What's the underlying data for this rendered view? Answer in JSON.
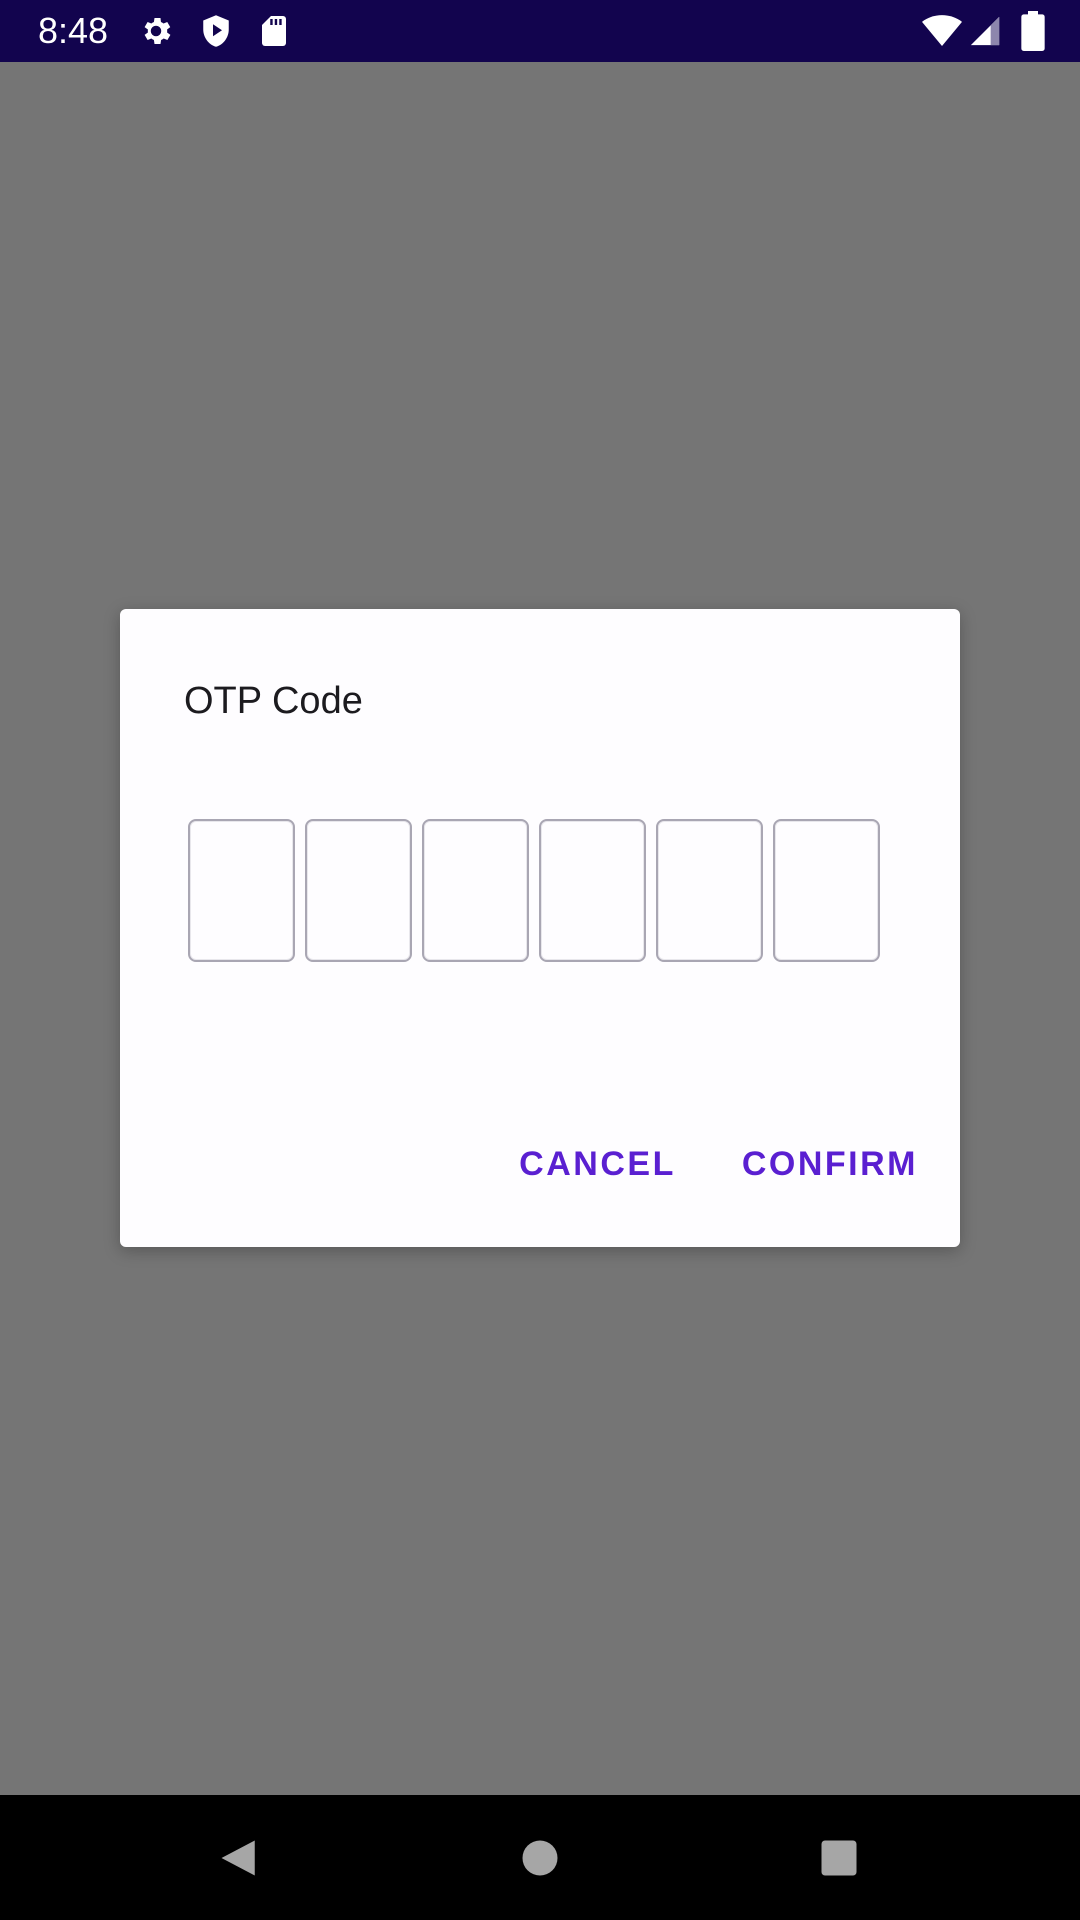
{
  "status_bar": {
    "time": "8:48",
    "icons": [
      "settings-gear-icon",
      "shield-play-icon",
      "sd-card-icon",
      "wifi-icon",
      "signal-icon",
      "battery-icon"
    ],
    "background_color": "#12044e"
  },
  "dialog": {
    "title": "OTP Code",
    "otp_fields": [
      {
        "value": ""
      },
      {
        "value": ""
      },
      {
        "value": ""
      },
      {
        "value": ""
      },
      {
        "value": ""
      },
      {
        "value": ""
      }
    ],
    "cancel_label": "CANCEL",
    "confirm_label": "CONFIRM",
    "accent_color": "#5a1fd1"
  },
  "nav_bar": {
    "icons": [
      "back-icon",
      "home-icon",
      "recents-icon"
    ]
  }
}
